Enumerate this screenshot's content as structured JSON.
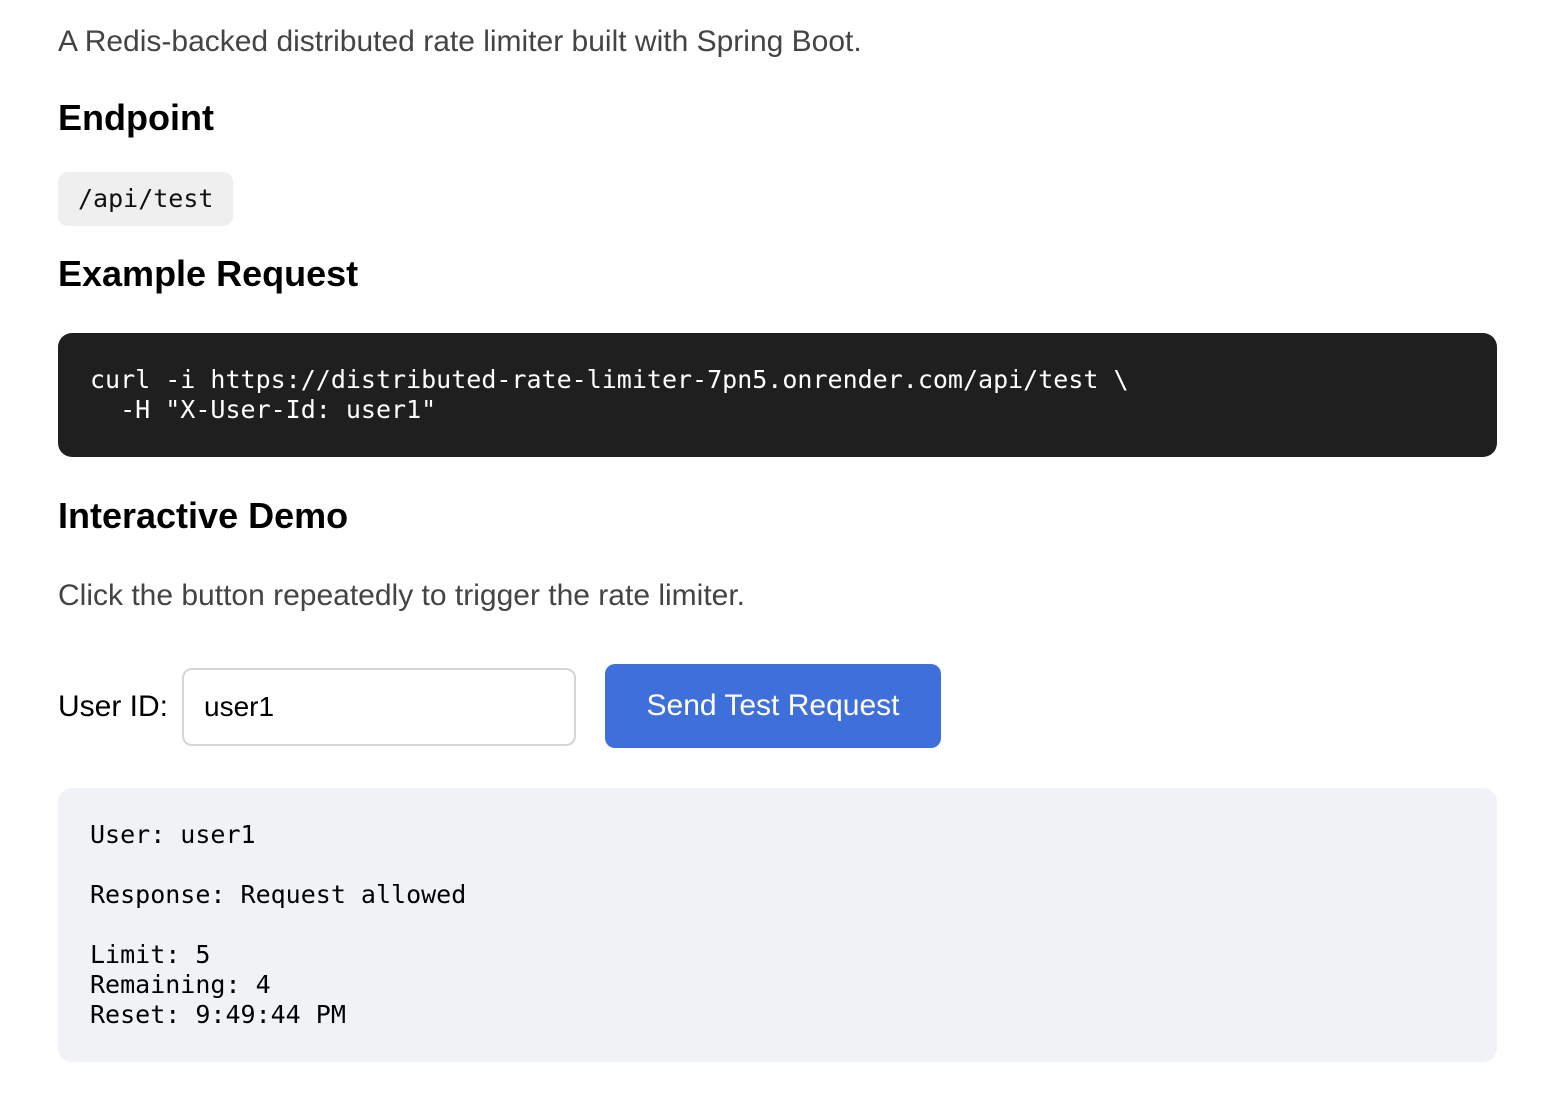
{
  "intro": "A Redis-backed distributed rate limiter built with Spring Boot.",
  "endpoint": {
    "heading": "Endpoint",
    "path": "/api/test"
  },
  "example": {
    "heading": "Example Request",
    "code_line_1": "curl -i https://distributed-rate-limiter-7pn5.onrender.com/api/test \\",
    "code_line_2": "  -H \"X-User-Id: user1\""
  },
  "demo": {
    "heading": "Interactive Demo",
    "description": "Click the button repeatedly to trigger the rate limiter.",
    "user_label": "User ID:",
    "user_value": "user1",
    "button_label": "Send Test Request"
  },
  "result": {
    "user_line": "User: user1",
    "response_line": "Response: Request allowed",
    "limit_line": "Limit: 5",
    "remaining_line": "Remaining: 4",
    "reset_line": "Reset: 9:49:44 PM"
  },
  "colors": {
    "button_bg": "#3f6fdb",
    "code_bg": "#1f1f1f",
    "result_bg": "#f0f2f5"
  }
}
